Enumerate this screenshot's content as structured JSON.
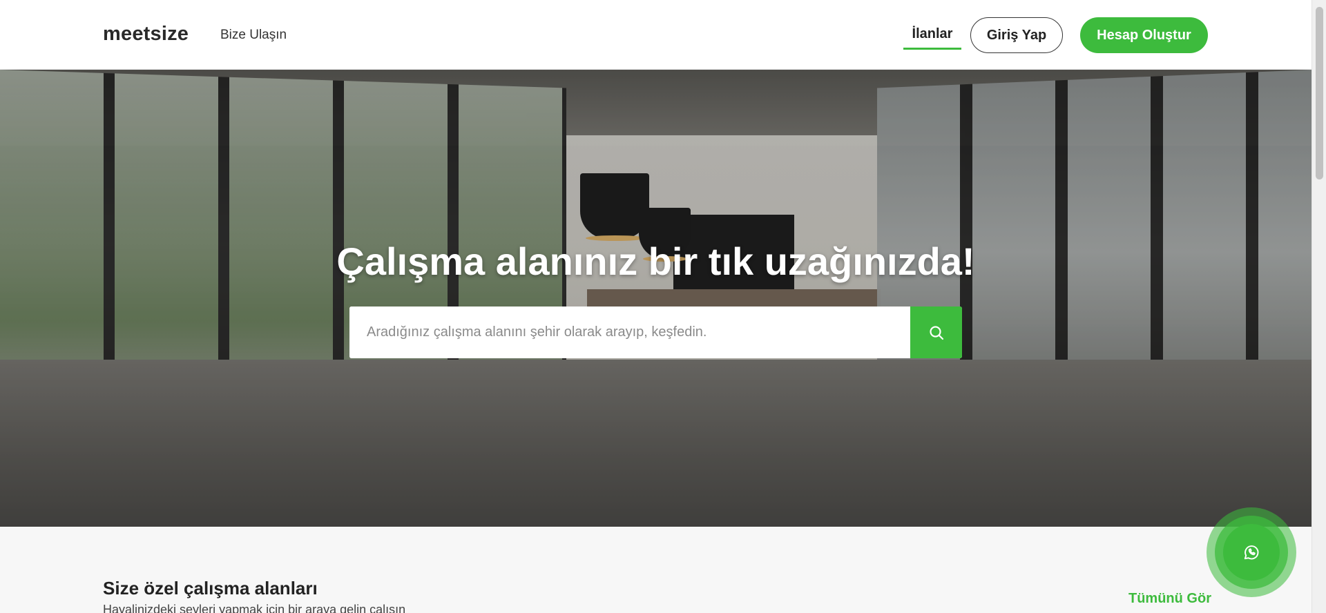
{
  "header": {
    "logo": "meetsize",
    "contact_link": "Bize Ulaşın",
    "nav_listings": "İlanlar",
    "login_button": "Giriş Yap",
    "register_button": "Hesap Oluştur"
  },
  "hero": {
    "title": "Çalışma alanınız bir tık uzağınızda!",
    "search": {
      "placeholder": "Aradığınız çalışma alanını şehir olarak arayıp, keşfedin.",
      "value": ""
    }
  },
  "section": {
    "title": "Size özel çalışma alanları",
    "subtitle": "Hayalinizdeki şeyleri yapmak için bir araya gelin çalışın",
    "see_all": "Tümünü Gör"
  },
  "colors": {
    "accent": "#3dbb3d",
    "text_dark": "#222222"
  },
  "icons": {
    "search": "search-icon",
    "whatsapp": "whatsapp-icon"
  }
}
